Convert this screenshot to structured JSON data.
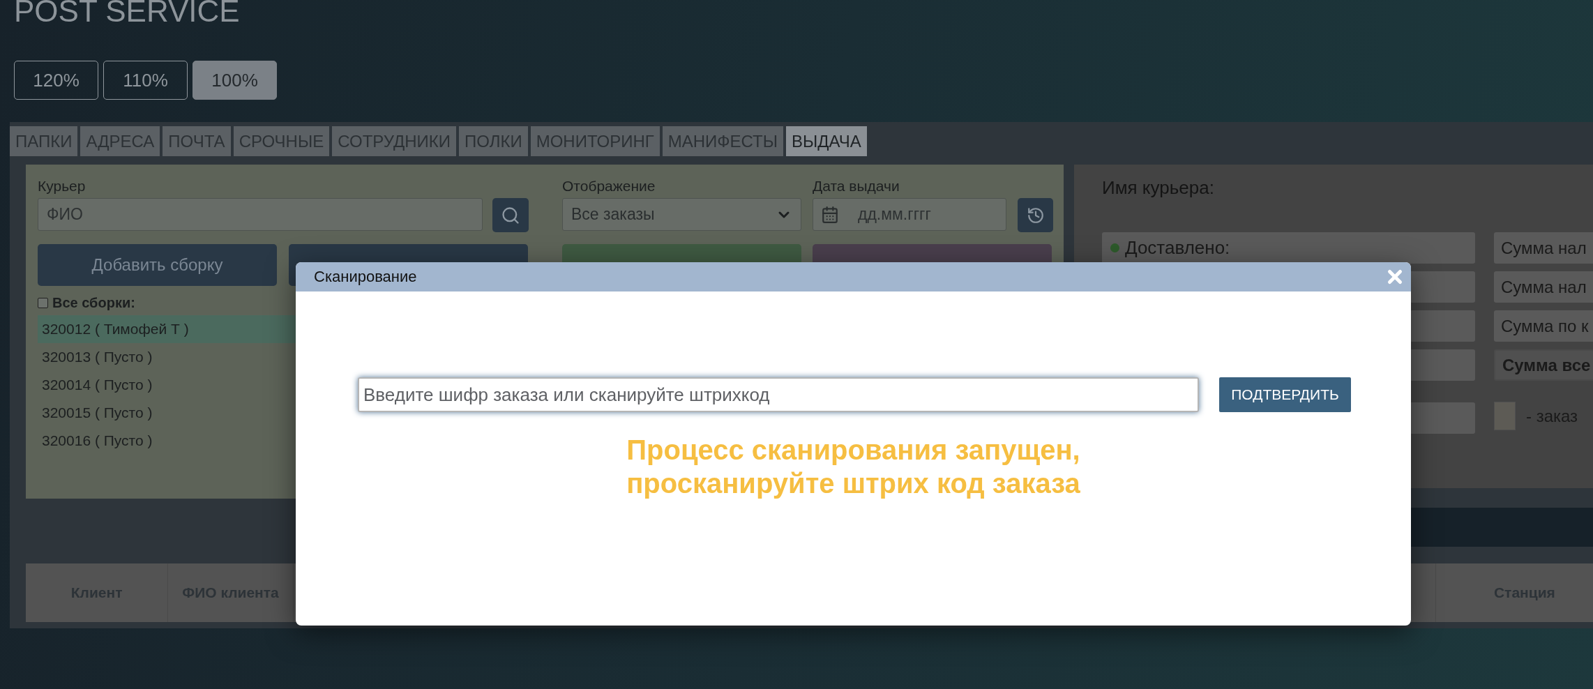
{
  "app_title": "POST SERVICE",
  "zoom_buttons": [
    {
      "label": "120%",
      "selected": false
    },
    {
      "label": "110%",
      "selected": false
    },
    {
      "label": "100%",
      "selected": true
    }
  ],
  "tabs": [
    {
      "label": "ПАПКИ",
      "selected": false
    },
    {
      "label": "АДРЕСА",
      "selected": false
    },
    {
      "label": "ПОЧТА",
      "selected": false
    },
    {
      "label": "СРОЧНЫЕ",
      "selected": false
    },
    {
      "label": "СОТРУДНИКИ",
      "selected": false
    },
    {
      "label": "ПОЛКИ",
      "selected": false
    },
    {
      "label": "МОНИТОРИНГ",
      "selected": false
    },
    {
      "label": "МАНИФЕСТЫ",
      "selected": false
    },
    {
      "label": "ВЫДАЧА",
      "selected": true
    }
  ],
  "courier_panel": {
    "courier_label": "Курьер",
    "courier_placeholder": "ФИО",
    "display_label": "Отображение",
    "display_value": "Все заказы",
    "date_label": "Дата выдачи",
    "date_placeholder": "дд.мм.гггг",
    "add_button": "Добавить сборку",
    "covered_buttons": [
      {
        "color": "#293846"
      },
      {
        "color": "#3f5a42"
      },
      {
        "color": "#4a3f4d"
      }
    ],
    "all_assemblies": {
      "label": "Все сборки:",
      "checked": false
    },
    "assemblies": [
      {
        "label": "320012 ( Тимофей Т )",
        "selected": true
      },
      {
        "label": "320013 ( Пусто )",
        "selected": false
      },
      {
        "label": "320014 ( Пусто )",
        "selected": false
      },
      {
        "label": "320015 ( Пусто )",
        "selected": false
      },
      {
        "label": "320016 ( Пусто )",
        "selected": false
      }
    ]
  },
  "summary_panel": {
    "courier_name_label": "Имя курьера:",
    "status_fields": [
      {
        "kind": "status",
        "label": "Доставлено:",
        "color": "#2d5a2b"
      },
      {
        "kind": "blank"
      },
      {
        "kind": "blank"
      },
      {
        "kind": "blank"
      },
      {
        "kind": "blank"
      }
    ],
    "sum_fields": [
      {
        "label": "Сумма нал",
        "bold": false
      },
      {
        "label": "Сумма нал",
        "bold": false
      },
      {
        "label": "Сумма по к",
        "bold": false
      },
      {
        "label": "Сумма все",
        "bold": true
      }
    ],
    "legend": {
      "label": "- заказ",
      "color": "#5d5b55"
    }
  },
  "table": {
    "columns": [
      {
        "kind": "text",
        "label": "Клиент"
      },
      {
        "kind": "text",
        "label": "ФИО клиента"
      },
      {
        "kind": "covered"
      },
      {
        "kind": "text",
        "label": "Станция"
      }
    ]
  },
  "modal": {
    "title": "Сканирование",
    "input_placeholder": "Введите шифр заказа или сканируйте штрихкод",
    "confirm_button": "ПОДТВЕРДИТЬ",
    "message": "Процесс сканирования запущен,\nпросканируйте штрих код заказа"
  }
}
